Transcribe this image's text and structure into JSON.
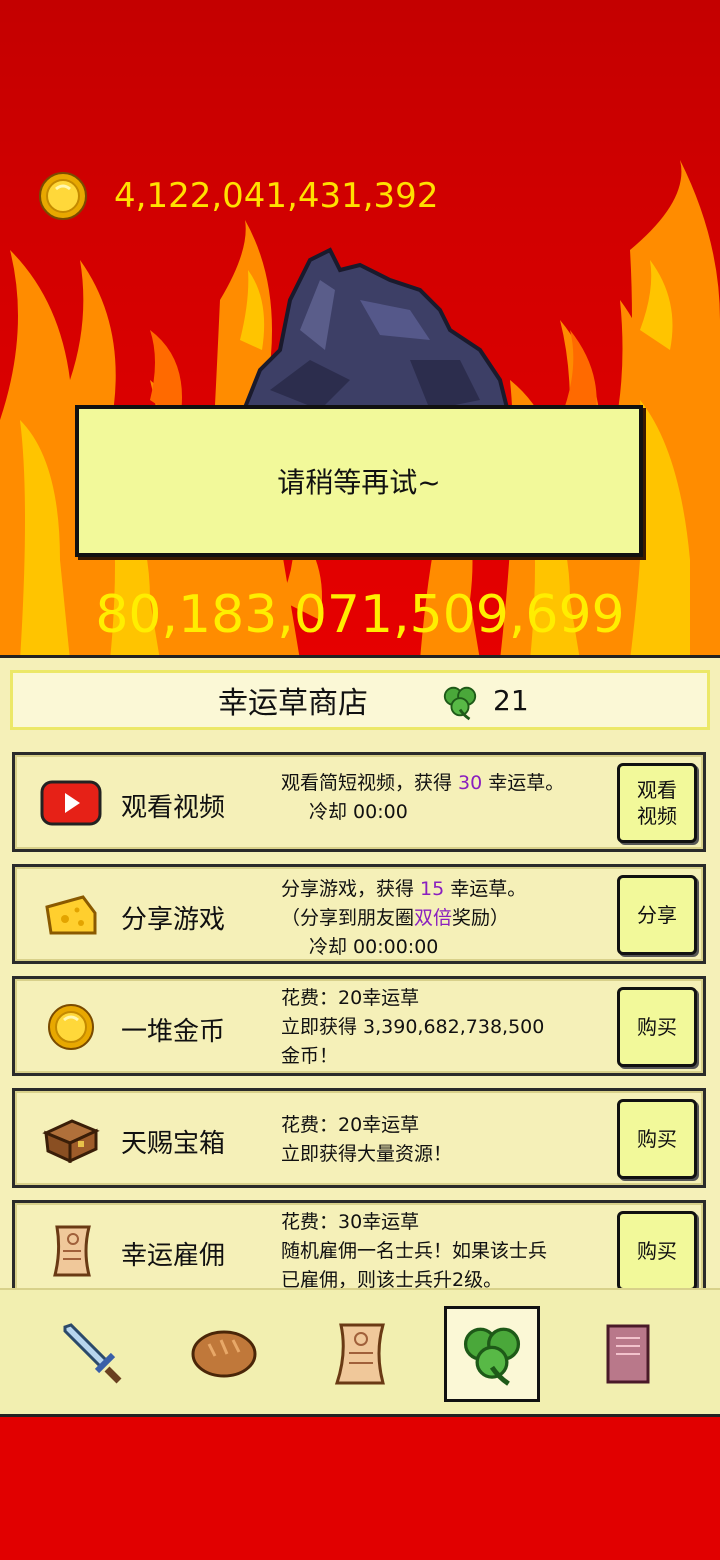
{
  "header": {
    "coins": "4,122,041,431,392",
    "dialog_message": "请稍等再试~",
    "boss_hp": "80,183,071,509,699"
  },
  "shop": {
    "title": "幸运草商店",
    "clover_count": "21",
    "items": [
      {
        "icon": "video-play-icon",
        "name": "观看视频",
        "desc1_pre": "观看简短视频，获得 ",
        "desc1_hl": "30",
        "desc1_post": " 幸运草。",
        "desc2": "冷却 00:00",
        "button_l1": "观看",
        "button_l2": "视频"
      },
      {
        "icon": "cheese-icon",
        "name": "分享游戏",
        "desc1_pre": "分享游戏，获得 ",
        "desc1_hl": "15",
        "desc1_post": " 幸运草。",
        "desc2_pre": "（分享到朋友圈",
        "desc2_hl": "双倍",
        "desc2_post": "奖励）",
        "desc3": "冷却 00:00:00",
        "button": "分享"
      },
      {
        "icon": "gold-coin-icon",
        "name": "一堆金币",
        "desc1": "花费：20幸运草",
        "desc2": "立即获得 3,390,682,738,500",
        "desc3": "金币！",
        "button": "购买"
      },
      {
        "icon": "treasure-chest-icon",
        "name": "天赐宝箱",
        "desc1": "花费：20幸运草",
        "desc2": "立即获得大量资源！",
        "button": "购买"
      },
      {
        "icon": "scroll-icon",
        "name": "幸运雇佣",
        "desc1": "花费：30幸运草",
        "desc2": "随机雇佣一名士兵！如果该士兵",
        "desc3": "已雇佣，则该士兵升2级。",
        "button": "购买"
      }
    ]
  },
  "tabs": [
    "sword-icon",
    "bread-icon",
    "scroll-icon",
    "clover-icon",
    "book-icon"
  ],
  "active_tab": "clover-icon",
  "colors": {
    "background": "#e10000",
    "panel": "#f5f0b8",
    "highlight": "#8a1fbf",
    "number": "#ffee00"
  }
}
